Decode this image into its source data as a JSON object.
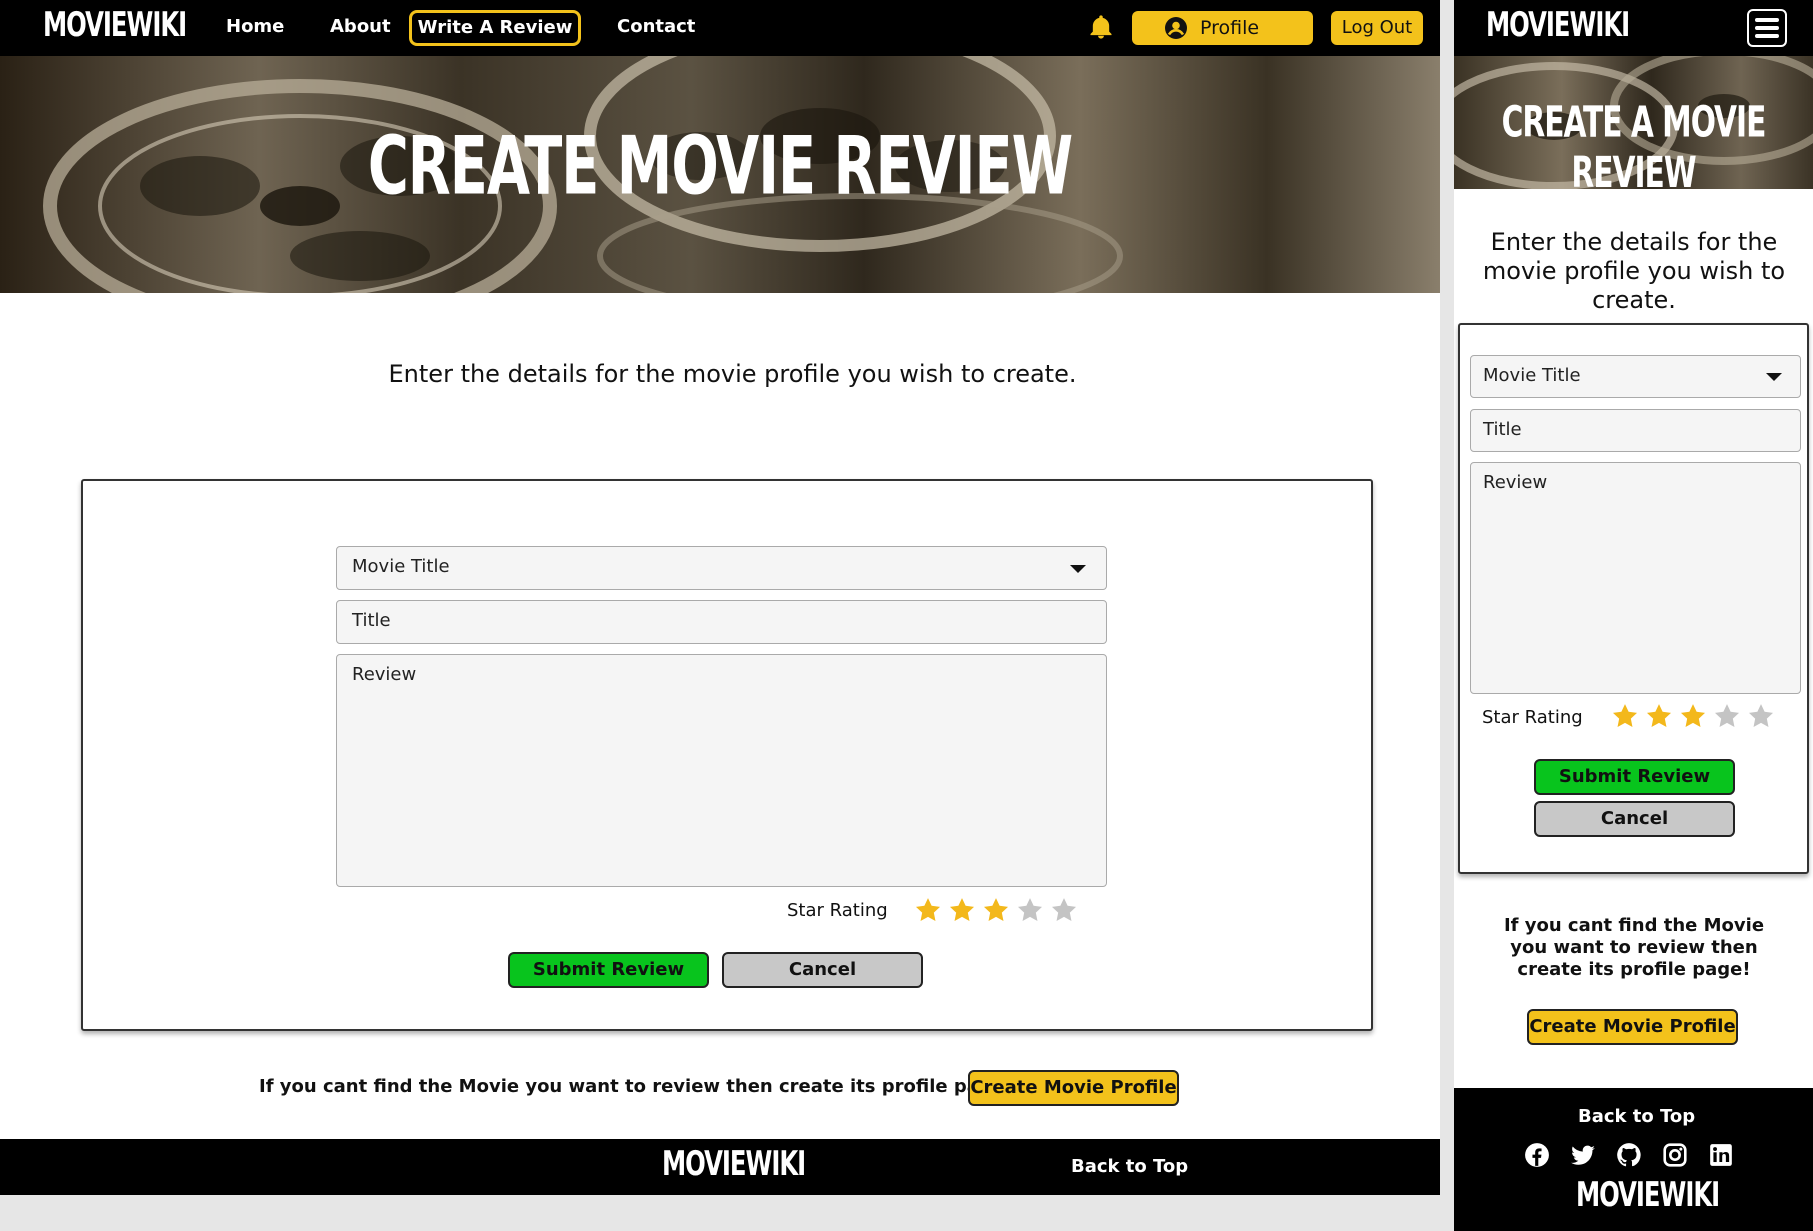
{
  "brand": "MOVIEWIKI",
  "nav": {
    "links": [
      "Home",
      "About",
      "Write A Review",
      "Contact"
    ],
    "profile_label": "Profile",
    "logout_label": "Log Out"
  },
  "hero": {
    "title_desktop": "CREATE MOVIE REVIEW",
    "title_mobile": "CREATE A MOVIE REVIEW"
  },
  "intro": {
    "desktop": "Enter the details for the movie profile you wish to create.",
    "mobile": "Enter the details for the movie profile you wish to create."
  },
  "form": {
    "movie_select_placeholder": "Movie Title",
    "title_placeholder": "Title",
    "review_placeholder": "Review",
    "star_label": "Star Rating",
    "rating": 3,
    "max_rating": 5,
    "submit_label": "Submit Review",
    "cancel_label": "Cancel"
  },
  "cta": {
    "text": "If you cant find the Movie you want to review then create its profile page!",
    "button_label": "Create Movie Profile"
  },
  "footer": {
    "back_to_top": "Back to Top",
    "social": [
      "facebook-icon",
      "twitter-icon",
      "github-icon",
      "instagram-icon",
      "linkedin-icon"
    ]
  },
  "colors": {
    "accent": "#f3c21b",
    "submit": "#08c41d",
    "cancel": "#c8c8c8",
    "star_on": "#f3b81b",
    "star_off": "#c4c4c4"
  }
}
